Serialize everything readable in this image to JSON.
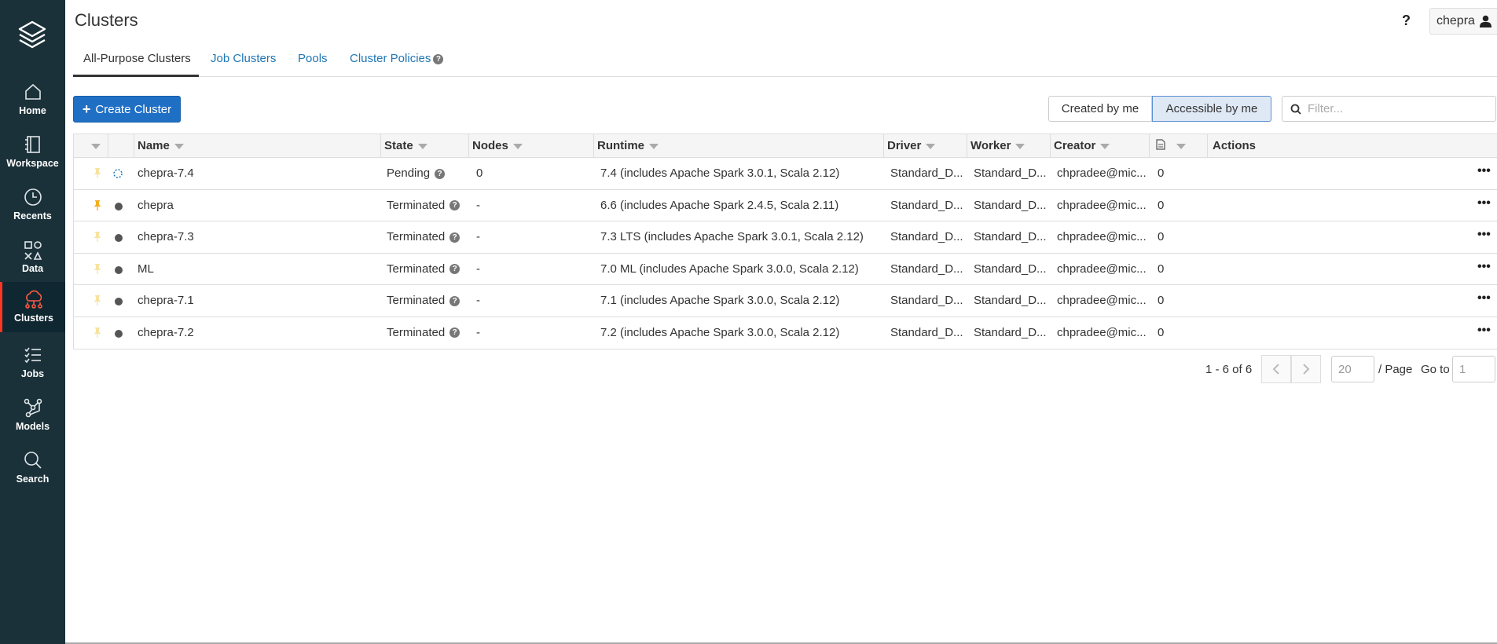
{
  "sidebar": {
    "items": [
      {
        "label": "Home",
        "icon": "home-icon"
      },
      {
        "label": "Workspace",
        "icon": "workspace-icon"
      },
      {
        "label": "Recents",
        "icon": "clock-icon"
      },
      {
        "label": "Data",
        "icon": "data-icon"
      },
      {
        "label": "Clusters",
        "icon": "cloud-icon",
        "active": true
      },
      {
        "label": "Jobs",
        "icon": "list-icon"
      },
      {
        "label": "Models",
        "icon": "models-icon"
      },
      {
        "label": "Search",
        "icon": "search-icon"
      }
    ]
  },
  "header": {
    "title": "Clusters",
    "help": "?",
    "user": "chepra"
  },
  "tabs": [
    {
      "label": "All-Purpose Clusters",
      "active": true
    },
    {
      "label": "Job Clusters"
    },
    {
      "label": "Pools"
    },
    {
      "label": "Cluster Policies"
    }
  ],
  "toolbar": {
    "create_label": "Create Cluster",
    "created_by_me": "Created by me",
    "accessible_by_me": "Accessible by me",
    "filter_placeholder": "Filter..."
  },
  "table": {
    "columns": [
      "Name",
      "State",
      "Nodes",
      "Runtime",
      "Driver",
      "Worker",
      "Creator",
      "Actions"
    ],
    "rows": [
      {
        "name": "chepra-7.4",
        "state": "Pending",
        "nodes": "0",
        "runtime": "7.4 (includes Apache Spark 3.0.1, Scala 2.12)",
        "driver": "Standard_D...",
        "worker": "Standard_D...",
        "creator": "chpradee@mic...",
        "notebooks": "0",
        "pinned": false,
        "status": "pending"
      },
      {
        "name": "chepra",
        "state": "Terminated",
        "nodes": "-",
        "runtime": "6.6 (includes Apache Spark 2.4.5, Scala 2.11)",
        "driver": "Standard_D...",
        "worker": "Standard_D...",
        "creator": "chpradee@mic...",
        "notebooks": "0",
        "pinned": true,
        "status": "terminated"
      },
      {
        "name": "chepra-7.3",
        "state": "Terminated",
        "nodes": "-",
        "runtime": "7.3 LTS (includes Apache Spark 3.0.1, Scala 2.12)",
        "driver": "Standard_D...",
        "worker": "Standard_D...",
        "creator": "chpradee@mic...",
        "notebooks": "0",
        "pinned": false,
        "status": "terminated"
      },
      {
        "name": "ML",
        "state": "Terminated",
        "nodes": "-",
        "runtime": "7.0 ML (includes Apache Spark 3.0.0, Scala 2.12)",
        "driver": "Standard_D...",
        "worker": "Standard_D...",
        "creator": "chpradee@mic...",
        "notebooks": "0",
        "pinned": false,
        "status": "terminated"
      },
      {
        "name": "chepra-7.1",
        "state": "Terminated",
        "nodes": "-",
        "runtime": "7.1 (includes Apache Spark 3.0.0, Scala 2.12)",
        "driver": "Standard_D...",
        "worker": "Standard_D...",
        "creator": "chpradee@mic...",
        "notebooks": "0",
        "pinned": false,
        "status": "terminated"
      },
      {
        "name": "chepra-7.2",
        "state": "Terminated",
        "nodes": "-",
        "runtime": "7.2 (includes Apache Spark 3.0.0, Scala 2.12)",
        "driver": "Standard_D...",
        "worker": "Standard_D...",
        "creator": "chpradee@mic...",
        "notebooks": "0",
        "pinned": false,
        "status": "terminated"
      }
    ],
    "more_label": "•••"
  },
  "pagination": {
    "range": "1 - 6 of 6",
    "page_size": "20",
    "per_page_label": "/ Page",
    "goto_label": "Go to",
    "goto_value": "1"
  },
  "colors": {
    "sidebar_bg": "#1b3139",
    "accent": "#ff3621",
    "primary": "#1f6fc5",
    "link": "#1f77b4"
  }
}
